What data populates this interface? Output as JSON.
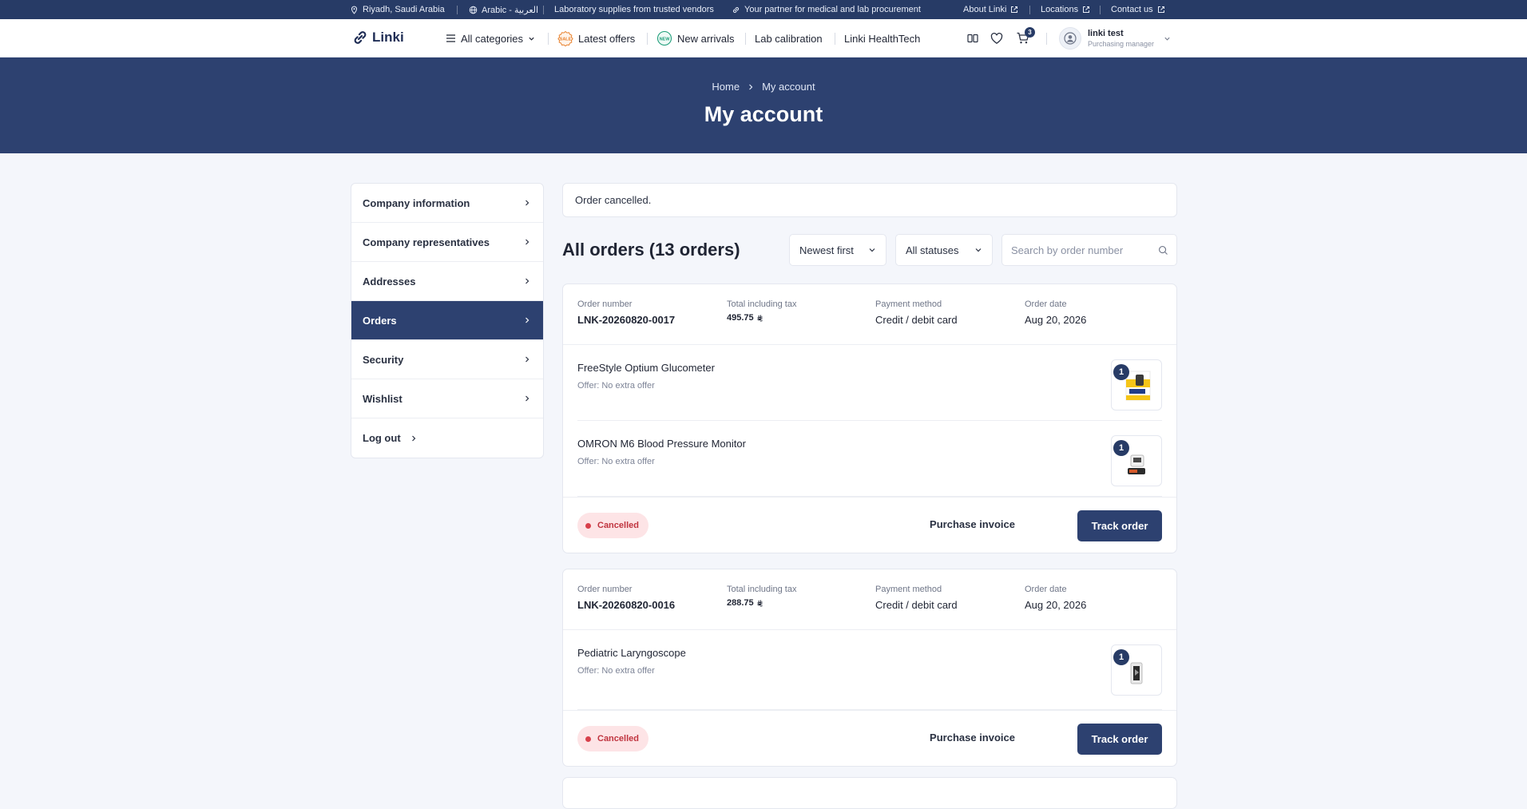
{
  "topbar": {
    "location": "Riyadh, Saudi Arabia",
    "language": "Arabic - العربية",
    "tagline1": "Laboratory supplies from trusted vendors",
    "tagline2": "Your partner for medical and lab procurement",
    "about": "About Linki",
    "locations": "Locations",
    "contact": "Contact us"
  },
  "header": {
    "logo": "Linki",
    "nav": {
      "all_categories": "All categories",
      "latest_offers": "Latest offers",
      "new_arrivals": "New arrivals",
      "lab_calibration": "Lab calibration",
      "healthtech": "Linki HealthTech"
    },
    "cart_count": "3",
    "user": {
      "name": "linki test",
      "role": "Purchasing manager"
    }
  },
  "hero": {
    "breadcrumb": {
      "home": "Home",
      "current": "My account"
    },
    "title": "My account"
  },
  "sidebar": {
    "items": [
      {
        "label": "Company information"
      },
      {
        "label": "Company representatives"
      },
      {
        "label": "Addresses"
      },
      {
        "label": "Orders"
      },
      {
        "label": "Security"
      },
      {
        "label": "Wishlist"
      },
      {
        "label": "Log out"
      }
    ]
  },
  "main": {
    "alert": "Order cancelled.",
    "title": "All orders (13 orders)",
    "sort": "Newest first",
    "status_filter": "All statuses",
    "search_placeholder": "Search by order number",
    "labels": {
      "order_number": "Order number",
      "total": "Total including tax",
      "payment": "Payment method",
      "date": "Order date",
      "purchase_invoice": "Purchase invoice",
      "track_order": "Track order"
    },
    "orders": [
      {
        "number": "LNK-20260820-0017",
        "total": "495.75",
        "payment": "Credit / debit card",
        "date": "Aug 20, 2026",
        "status": "Cancelled",
        "items": [
          {
            "name": "FreeStyle Optium Glucometer",
            "offer": "Offer: No extra offer",
            "qty": "1"
          },
          {
            "name": "OMRON M6 Blood Pressure Monitor",
            "offer": "Offer: No extra offer",
            "qty": "1"
          }
        ]
      },
      {
        "number": "LNK-20260820-0016",
        "total": "288.75",
        "payment": "Credit / debit card",
        "date": "Aug 20, 2026",
        "status": "Cancelled",
        "items": [
          {
            "name": "Pediatric Laryngoscope",
            "offer": "Offer: No extra offer",
            "qty": "1"
          }
        ]
      }
    ]
  },
  "colors": {
    "topbar": "#273b66",
    "primary": "#2d4170",
    "cancelled_bg": "#fde4e6",
    "cancelled_text": "#c0343f"
  }
}
